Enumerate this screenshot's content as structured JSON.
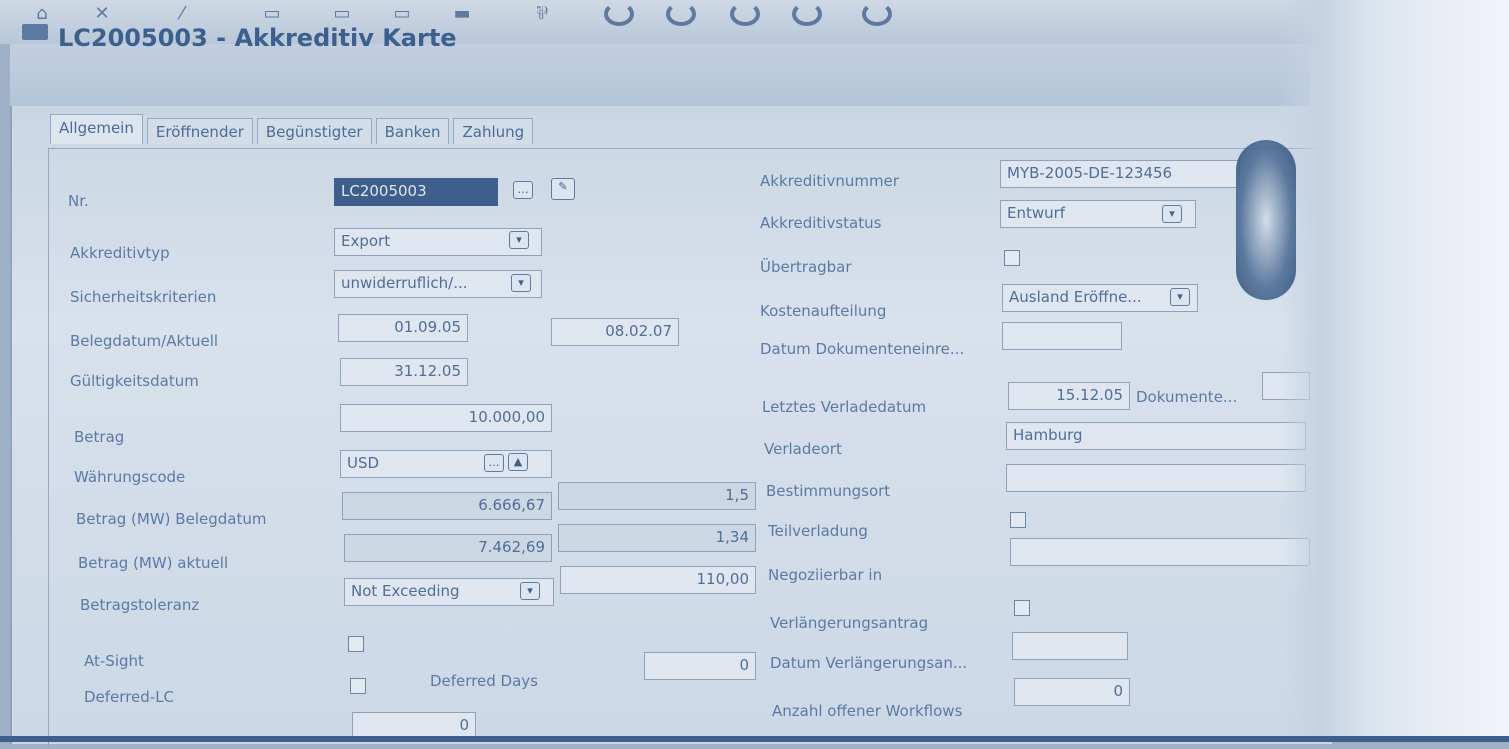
{
  "window": {
    "title": "LC2005003 - Akkreditiv Karte"
  },
  "tabs": [
    {
      "label": "Allgemein"
    },
    {
      "label": "Eröffnender"
    },
    {
      "label": "Begünstigter"
    },
    {
      "label": "Banken"
    },
    {
      "label": "Zahlung"
    }
  ],
  "left": {
    "nr": {
      "label": "Nr.",
      "value": "LC2005003"
    },
    "akkreditivtyp": {
      "label": "Akkreditivtyp",
      "value": "Export"
    },
    "sicherheit": {
      "label": "Sicherheitskriterien",
      "value": "unwiderruflich/..."
    },
    "belegdatum": {
      "label": "Belegdatum/Aktuell",
      "value1": "01.09.05",
      "value2": "08.02.07"
    },
    "gueltig": {
      "label": "Gültigkeitsdatum",
      "value": "31.12.05"
    },
    "betrag": {
      "label": "Betrag",
      "value": "10.000,00"
    },
    "waehrung": {
      "label": "Währungscode",
      "value": "USD"
    },
    "betrag_mw_beleg": {
      "label": "Betrag (MW) Belegdatum",
      "value": "6.666,67",
      "rate": "1,5"
    },
    "betrag_mw_akt": {
      "label": "Betrag (MW) aktuell",
      "value": "7.462,69",
      "rate": "1,34"
    },
    "toleranz": {
      "label": "Betragstoleranz",
      "value": "Not Exceeding",
      "percent": "110,00"
    },
    "at_sight": {
      "label": "At-Sight"
    },
    "deferred_lc": {
      "label": "Deferred-LC"
    },
    "deferred_days": {
      "label": "Deferred Days",
      "value": "0"
    },
    "bottom_value": "0"
  },
  "right": {
    "akkreditivnummer": {
      "label": "Akkreditivnummer",
      "value": "MYB-2005-DE-123456"
    },
    "akkreditivstatus": {
      "label": "Akkreditivstatus",
      "value": "Entwurf"
    },
    "uebertragbar": {
      "label": "Übertragbar"
    },
    "kostenaufteilung": {
      "label": "Kostenaufteilung",
      "value": "Ausland Eröffne..."
    },
    "datum_dokumente": {
      "label": "Datum Dokumenteneinre..."
    },
    "letztes_verladedatum": {
      "label": "Letztes Verladedatum",
      "value": "15.12.05",
      "dok_label": "Dokumente..."
    },
    "verladeort": {
      "label": "Verladeort",
      "value": "Hamburg"
    },
    "bestimmungsort": {
      "label": "Bestimmungsort"
    },
    "teilverladung": {
      "label": "Teilverladung"
    },
    "negoziierbar": {
      "label": "Negoziierbar in"
    },
    "verlaengerungsantrag": {
      "label": "Verlängerungsantrag"
    },
    "datum_verlaengerung": {
      "label": "Datum Verlängerungsan..."
    },
    "workflows": {
      "label": "Anzahl offener Workflows",
      "value": "0"
    }
  }
}
